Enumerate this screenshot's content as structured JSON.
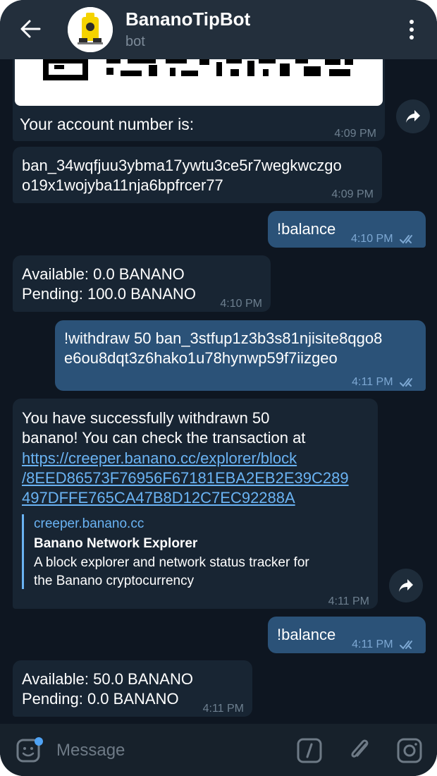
{
  "header": {
    "title": "BananoTipBot",
    "subtitle": "bot"
  },
  "messages": {
    "m1": {
      "text": "Your account number is:",
      "time": "4:09 PM"
    },
    "m2": {
      "line1": "ban_34wqfjuu3ybma17ywtu3ce5r7wegkwczgo",
      "line2": "o19x1wojyba11nja6bpfrcer77",
      "time": "4:09 PM"
    },
    "m3": {
      "text": "!balance",
      "time": "4:10 PM"
    },
    "m4": {
      "line1": "Available: 0.0 BANANO",
      "line2": "Pending: 100.0 BANANO",
      "time": "4:10 PM"
    },
    "m5": {
      "line1": "!withdraw 50 ban_3stfup1z3b3s81njisite8qgo8",
      "line2": "e6ou8dqt3z6hako1u78hynwp59f7iizgeo",
      "time": "4:11 PM"
    },
    "m6": {
      "line1": "You have successfully withdrawn 50",
      "line2": "banano!  You can check the transaction at",
      "link1": "https://creeper.banano.cc/explorer/block",
      "link2": "/8EED86573F76956F67181EBA2EB2E39C289",
      "link3": "497DFFE765CA47B8D12C7EC92288A",
      "preview_site": "creeper.banano.cc",
      "preview_title": "Banano Network Explorer",
      "preview_desc1": "A block explorer and network status tracker for",
      "preview_desc2": "the Banano cryptocurrency",
      "time": "4:11 PM"
    },
    "m7": {
      "text": "!balance",
      "time": "4:11 PM"
    },
    "m8": {
      "line1": "Available: 50.0 BANANO",
      "line2": "Pending: 0.0 BANANO",
      "time": "4:11 PM"
    }
  },
  "input": {
    "placeholder": "Message"
  },
  "colors": {
    "background": "#0e1621",
    "incoming_bubble": "#182533",
    "outgoing_bubble": "#2b5278",
    "link": "#6ab3f3",
    "header": "#232f3c"
  },
  "icons": [
    "back-arrow-icon",
    "more-vertical-icon",
    "share-icon",
    "sticker-icon",
    "command-icon",
    "attach-icon",
    "camera-icon",
    "double-check-icon"
  ]
}
